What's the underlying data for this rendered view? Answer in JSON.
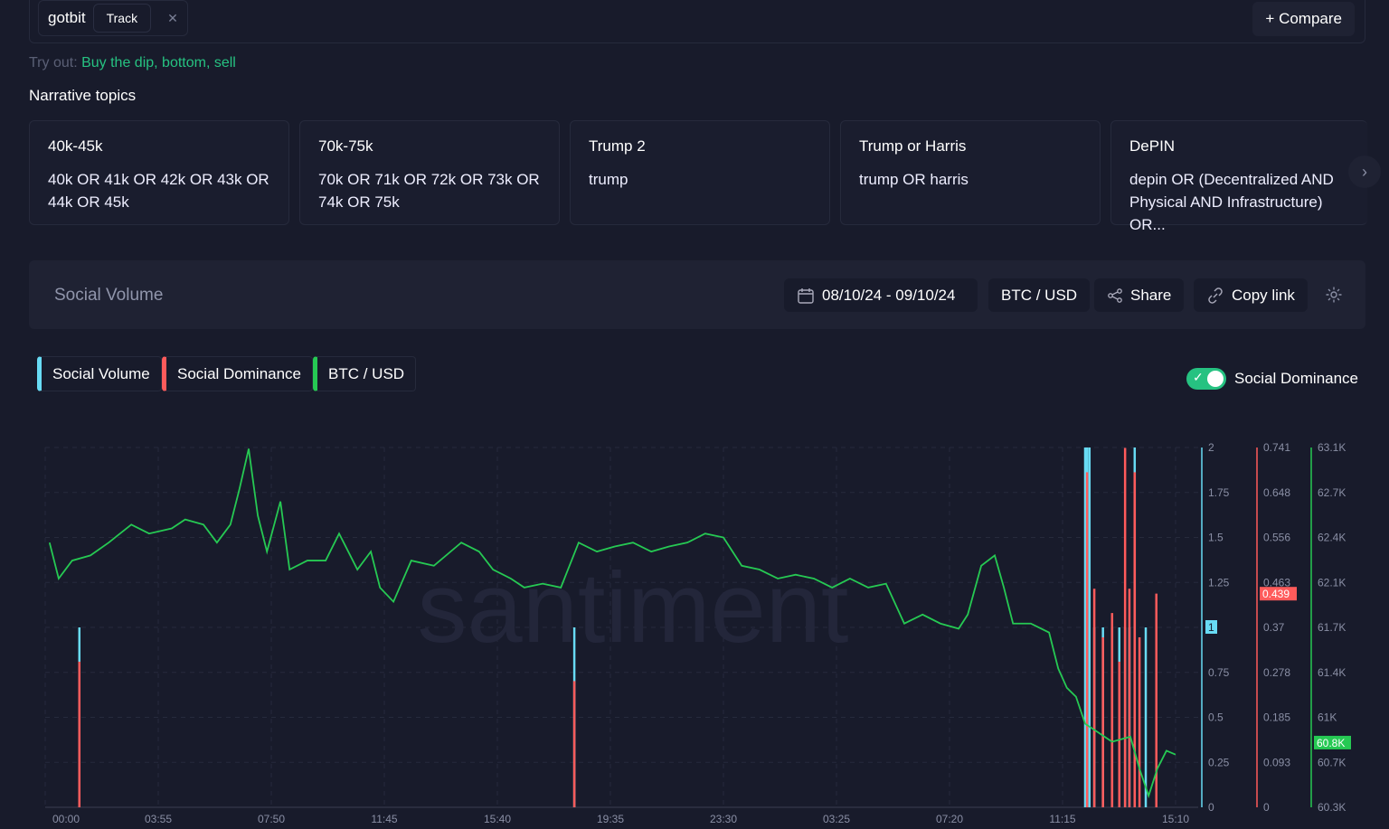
{
  "search": {
    "keyword": "gotbit",
    "track_label": "Track",
    "compare_label": "+ Compare"
  },
  "tryout": {
    "prefix": "Try out:",
    "suggestions": "Buy the dip, bottom, sell"
  },
  "narrative": {
    "title": "Narrative topics",
    "cards": [
      {
        "title": "40k-45k",
        "query": "40k OR 41k OR 42k OR 43k OR 44k OR 45k"
      },
      {
        "title": "70k-75k",
        "query": "70k OR 71k OR 72k OR 73k OR 74k OR 75k"
      },
      {
        "title": "Trump 2",
        "query": "trump"
      },
      {
        "title": "Trump or Harris",
        "query": "trump OR harris"
      },
      {
        "title": "DePIN",
        "query": "depin OR (Decentralized AND Physical AND Infrastructure) OR..."
      }
    ]
  },
  "panel": {
    "title": "Social Volume",
    "date_range": "08/10/24 - 09/10/24",
    "pair": "BTC / USD",
    "share": "Share",
    "copy_link": "Copy link"
  },
  "legend": [
    {
      "label": "Social Volume",
      "color": "#68dbf4"
    },
    {
      "label": "Social Dominance",
      "color": "#ff5b5b"
    },
    {
      "label": "BTC / USD",
      "color": "#26c953"
    }
  ],
  "toggle": {
    "label": "Social Dominance",
    "on": true
  },
  "watermark": "santiment",
  "chart_data": {
    "type": "line",
    "x_range_minutes": [
      0,
      2397
    ],
    "xticks": [
      {
        "t": 0,
        "label": "00:00"
      },
      {
        "t": 235,
        "label": "03:55"
      },
      {
        "t": 470,
        "label": "07:50"
      },
      {
        "t": 705,
        "label": "11:45"
      },
      {
        "t": 940,
        "label": "15:40"
      },
      {
        "t": 1175,
        "label": "19:35"
      },
      {
        "t": 1410,
        "label": "23:30"
      },
      {
        "t": 1645,
        "label": "03:25"
      },
      {
        "t": 1880,
        "label": "07:20"
      },
      {
        "t": 2115,
        "label": "11:15"
      },
      {
        "t": 2350,
        "label": "15:10"
      }
    ],
    "axes": [
      {
        "name": "Social Volume",
        "color": "#68dbf4",
        "range": [
          0,
          2
        ],
        "ticks": [
          "0",
          "0.25",
          "0.5",
          "0.75",
          "1",
          "1.25",
          "1.5",
          "1.75",
          "2"
        ],
        "current": "1",
        "current_value": 1
      },
      {
        "name": "Social Dominance",
        "color": "#ff5b5b",
        "range": [
          0,
          0.741
        ],
        "ticks": [
          "0",
          "0.093",
          "0.185",
          "0.278",
          "0.37",
          "0.463",
          "0.556",
          "0.648",
          "0.741"
        ],
        "current": "0.439",
        "current_value": 0.439
      },
      {
        "name": "BTC / USD",
        "color": "#26c953",
        "range": [
          60.3,
          63.1
        ],
        "ticks": [
          "60.3K",
          "60.7K",
          "61K",
          "61.4K",
          "61.7K",
          "62.1K",
          "62.4K",
          "62.7K",
          "63.1K"
        ],
        "current": "60.8K",
        "current_value": 60.8
      }
    ],
    "btc": [
      [
        9,
        62.36
      ],
      [
        28,
        62.08
      ],
      [
        56,
        62.22
      ],
      [
        94,
        62.26
      ],
      [
        132,
        62.36
      ],
      [
        179,
        62.5
      ],
      [
        216,
        62.43
      ],
      [
        263,
        62.47
      ],
      [
        291,
        62.54
      ],
      [
        329,
        62.5
      ],
      [
        357,
        62.36
      ],
      [
        385,
        62.5
      ],
      [
        404,
        62.78
      ],
      [
        423,
        63.09
      ],
      [
        442,
        62.57
      ],
      [
        461,
        62.29
      ],
      [
        489,
        62.68
      ],
      [
        508,
        62.15
      ],
      [
        545,
        62.22
      ],
      [
        583,
        62.22
      ],
      [
        611,
        62.43
      ],
      [
        649,
        62.15
      ],
      [
        677,
        62.29
      ],
      [
        696,
        62.01
      ],
      [
        724,
        61.9
      ],
      [
        761,
        62.22
      ],
      [
        808,
        62.18
      ],
      [
        865,
        62.36
      ],
      [
        902,
        62.29
      ],
      [
        931,
        62.15
      ],
      [
        968,
        62.08
      ],
      [
        996,
        62.01
      ],
      [
        1034,
        62.04
      ],
      [
        1072,
        62.01
      ],
      [
        1109,
        62.36
      ],
      [
        1147,
        62.29
      ],
      [
        1184,
        62.33
      ],
      [
        1222,
        62.36
      ],
      [
        1260,
        62.29
      ],
      [
        1297,
        62.33
      ],
      [
        1335,
        62.36
      ],
      [
        1372,
        62.43
      ],
      [
        1410,
        62.4
      ],
      [
        1448,
        62.18
      ],
      [
        1485,
        62.15
      ],
      [
        1523,
        62.08
      ],
      [
        1560,
        62.11
      ],
      [
        1598,
        62.08
      ],
      [
        1636,
        62.01
      ],
      [
        1673,
        62.08
      ],
      [
        1711,
        62.01
      ],
      [
        1748,
        62.04
      ],
      [
        1786,
        61.73
      ],
      [
        1824,
        61.8
      ],
      [
        1861,
        61.73
      ],
      [
        1899,
        61.69
      ],
      [
        1918,
        61.8
      ],
      [
        1946,
        62.18
      ],
      [
        1974,
        62.26
      ],
      [
        1993,
        62.01
      ],
      [
        2012,
        61.73
      ],
      [
        2049,
        61.73
      ],
      [
        2087,
        61.66
      ],
      [
        2106,
        61.38
      ],
      [
        2124,
        61.23
      ],
      [
        2143,
        61.16
      ],
      [
        2162,
        60.95
      ],
      [
        2190,
        60.88
      ],
      [
        2218,
        60.81
      ],
      [
        2256,
        60.85
      ],
      [
        2275,
        60.6
      ],
      [
        2294,
        60.39
      ],
      [
        2312,
        60.6
      ],
      [
        2331,
        60.74
      ],
      [
        2350,
        60.71
      ]
    ],
    "social_volume": [
      [
        71,
        1
      ],
      [
        1100,
        1
      ],
      [
        2162,
        2
      ],
      [
        2166,
        2
      ],
      [
        2171,
        2
      ],
      [
        2181,
        1
      ],
      [
        2199,
        1
      ],
      [
        2218,
        1
      ],
      [
        2233,
        1
      ],
      [
        2245,
        1
      ],
      [
        2254,
        1
      ],
      [
        2265,
        2
      ],
      [
        2288,
        1
      ]
    ],
    "social_dominance": [
      [
        71,
        0.3
      ],
      [
        1100,
        0.26
      ],
      [
        2166,
        0.69
      ],
      [
        2181,
        0.45
      ],
      [
        2199,
        0.35
      ],
      [
        2218,
        0.4
      ],
      [
        2233,
        0.3
      ],
      [
        2245,
        0.74
      ],
      [
        2254,
        0.45
      ],
      [
        2265,
        0.69
      ],
      [
        2275,
        0.35
      ],
      [
        2310,
        0.44
      ]
    ]
  }
}
